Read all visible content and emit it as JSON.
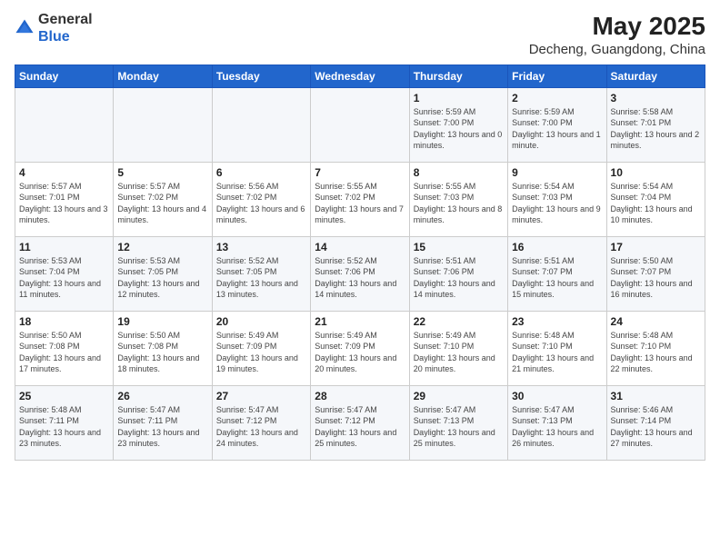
{
  "logo": {
    "general": "General",
    "blue": "Blue"
  },
  "title": "May 2025",
  "subtitle": "Decheng, Guangdong, China",
  "days_header": [
    "Sunday",
    "Monday",
    "Tuesday",
    "Wednesday",
    "Thursday",
    "Friday",
    "Saturday"
  ],
  "weeks": [
    [
      {
        "day": "",
        "info": ""
      },
      {
        "day": "",
        "info": ""
      },
      {
        "day": "",
        "info": ""
      },
      {
        "day": "",
        "info": ""
      },
      {
        "day": "1",
        "info": "Sunrise: 5:59 AM\nSunset: 7:00 PM\nDaylight: 13 hours\nand 0 minutes."
      },
      {
        "day": "2",
        "info": "Sunrise: 5:59 AM\nSunset: 7:00 PM\nDaylight: 13 hours\nand 1 minute."
      },
      {
        "day": "3",
        "info": "Sunrise: 5:58 AM\nSunset: 7:01 PM\nDaylight: 13 hours\nand 2 minutes."
      }
    ],
    [
      {
        "day": "4",
        "info": "Sunrise: 5:57 AM\nSunset: 7:01 PM\nDaylight: 13 hours\nand 3 minutes."
      },
      {
        "day": "5",
        "info": "Sunrise: 5:57 AM\nSunset: 7:02 PM\nDaylight: 13 hours\nand 4 minutes."
      },
      {
        "day": "6",
        "info": "Sunrise: 5:56 AM\nSunset: 7:02 PM\nDaylight: 13 hours\nand 6 minutes."
      },
      {
        "day": "7",
        "info": "Sunrise: 5:55 AM\nSunset: 7:02 PM\nDaylight: 13 hours\nand 7 minutes."
      },
      {
        "day": "8",
        "info": "Sunrise: 5:55 AM\nSunset: 7:03 PM\nDaylight: 13 hours\nand 8 minutes."
      },
      {
        "day": "9",
        "info": "Sunrise: 5:54 AM\nSunset: 7:03 PM\nDaylight: 13 hours\nand 9 minutes."
      },
      {
        "day": "10",
        "info": "Sunrise: 5:54 AM\nSunset: 7:04 PM\nDaylight: 13 hours\nand 10 minutes."
      }
    ],
    [
      {
        "day": "11",
        "info": "Sunrise: 5:53 AM\nSunset: 7:04 PM\nDaylight: 13 hours\nand 11 minutes."
      },
      {
        "day": "12",
        "info": "Sunrise: 5:53 AM\nSunset: 7:05 PM\nDaylight: 13 hours\nand 12 minutes."
      },
      {
        "day": "13",
        "info": "Sunrise: 5:52 AM\nSunset: 7:05 PM\nDaylight: 13 hours\nand 13 minutes."
      },
      {
        "day": "14",
        "info": "Sunrise: 5:52 AM\nSunset: 7:06 PM\nDaylight: 13 hours\nand 14 minutes."
      },
      {
        "day": "15",
        "info": "Sunrise: 5:51 AM\nSunset: 7:06 PM\nDaylight: 13 hours\nand 14 minutes."
      },
      {
        "day": "16",
        "info": "Sunrise: 5:51 AM\nSunset: 7:07 PM\nDaylight: 13 hours\nand 15 minutes."
      },
      {
        "day": "17",
        "info": "Sunrise: 5:50 AM\nSunset: 7:07 PM\nDaylight: 13 hours\nand 16 minutes."
      }
    ],
    [
      {
        "day": "18",
        "info": "Sunrise: 5:50 AM\nSunset: 7:08 PM\nDaylight: 13 hours\nand 17 minutes."
      },
      {
        "day": "19",
        "info": "Sunrise: 5:50 AM\nSunset: 7:08 PM\nDaylight: 13 hours\nand 18 minutes."
      },
      {
        "day": "20",
        "info": "Sunrise: 5:49 AM\nSunset: 7:09 PM\nDaylight: 13 hours\nand 19 minutes."
      },
      {
        "day": "21",
        "info": "Sunrise: 5:49 AM\nSunset: 7:09 PM\nDaylight: 13 hours\nand 20 minutes."
      },
      {
        "day": "22",
        "info": "Sunrise: 5:49 AM\nSunset: 7:10 PM\nDaylight: 13 hours\nand 20 minutes."
      },
      {
        "day": "23",
        "info": "Sunrise: 5:48 AM\nSunset: 7:10 PM\nDaylight: 13 hours\nand 21 minutes."
      },
      {
        "day": "24",
        "info": "Sunrise: 5:48 AM\nSunset: 7:10 PM\nDaylight: 13 hours\nand 22 minutes."
      }
    ],
    [
      {
        "day": "25",
        "info": "Sunrise: 5:48 AM\nSunset: 7:11 PM\nDaylight: 13 hours\nand 23 minutes."
      },
      {
        "day": "26",
        "info": "Sunrise: 5:47 AM\nSunset: 7:11 PM\nDaylight: 13 hours\nand 23 minutes."
      },
      {
        "day": "27",
        "info": "Sunrise: 5:47 AM\nSunset: 7:12 PM\nDaylight: 13 hours\nand 24 minutes."
      },
      {
        "day": "28",
        "info": "Sunrise: 5:47 AM\nSunset: 7:12 PM\nDaylight: 13 hours\nand 25 minutes."
      },
      {
        "day": "29",
        "info": "Sunrise: 5:47 AM\nSunset: 7:13 PM\nDaylight: 13 hours\nand 25 minutes."
      },
      {
        "day": "30",
        "info": "Sunrise: 5:47 AM\nSunset: 7:13 PM\nDaylight: 13 hours\nand 26 minutes."
      },
      {
        "day": "31",
        "info": "Sunrise: 5:46 AM\nSunset: 7:14 PM\nDaylight: 13 hours\nand 27 minutes."
      }
    ]
  ]
}
